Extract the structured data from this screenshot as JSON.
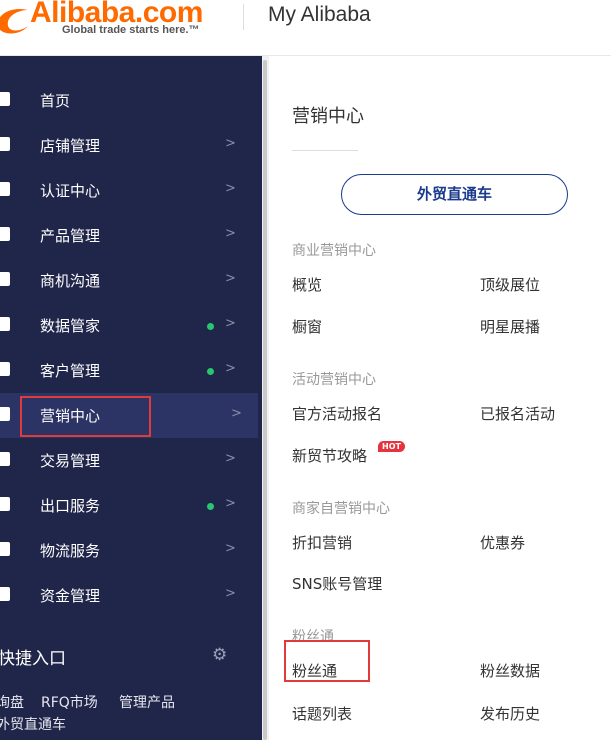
{
  "header": {
    "logo_text": "Alibaba.com",
    "logo_tagline": "Global trade starts here.™",
    "title": "My Alibaba"
  },
  "sidebar": {
    "items": [
      {
        "label": "首页",
        "icon": "home-icon",
        "dot": false,
        "arrow": ""
      },
      {
        "label": "店铺管理",
        "icon": "store-icon",
        "dot": false,
        "arrow": ">"
      },
      {
        "label": "认证中心",
        "icon": "shield-icon",
        "dot": false,
        "arrow": ">"
      },
      {
        "label": "产品管理",
        "icon": "product-icon",
        "dot": false,
        "arrow": ">"
      },
      {
        "label": "商机沟通",
        "icon": "chat-icon",
        "dot": false,
        "arrow": ">"
      },
      {
        "label": "数据管家",
        "icon": "bar-chart-icon",
        "dot": true,
        "arrow": ">"
      },
      {
        "label": "客户管理",
        "icon": "users-icon",
        "dot": true,
        "arrow": ">"
      },
      {
        "label": "营销中心",
        "icon": "share-icon",
        "dot": false,
        "arrow": ">",
        "active": true
      },
      {
        "label": "交易管理",
        "icon": "document-icon",
        "dot": false,
        "arrow": ">"
      },
      {
        "label": "出口服务",
        "icon": "globe-icon",
        "dot": true,
        "arrow": ">"
      },
      {
        "label": "物流服务",
        "icon": "truck-icon",
        "dot": false,
        "arrow": ">"
      },
      {
        "label": "资金管理",
        "icon": "bank-icon",
        "dot": false,
        "arrow": ">"
      }
    ],
    "quick_title": "快捷入口",
    "quick_links": [
      "询盘",
      "RFQ市场",
      "管理产品",
      "外贸直通车"
    ]
  },
  "main": {
    "title": "营销中心",
    "cta_button": "外贸直通车",
    "sections": [
      {
        "heading": "商业营销中心",
        "links": [
          "概览",
          "顶级展位",
          "橱窗",
          "明星展播"
        ]
      },
      {
        "heading": "活动营销中心",
        "links": [
          "官方活动报名",
          "已报名活动",
          "新贸节攻略"
        ]
      },
      {
        "heading": "商家自营销中心",
        "links": [
          "折扣营销",
          "优惠券",
          "SNS账号管理"
        ]
      },
      {
        "heading": "粉丝通",
        "links": [
          "粉丝通",
          "粉丝数据",
          "话题列表",
          "发布历史"
        ]
      }
    ],
    "hot_badge": "HOT"
  },
  "colors": {
    "sidebar_bg": "#20254a",
    "active_bg": "#2b3465",
    "accent": "#ff6a00",
    "highlight": "#e03a3a",
    "status_dot": "#28c76f"
  }
}
